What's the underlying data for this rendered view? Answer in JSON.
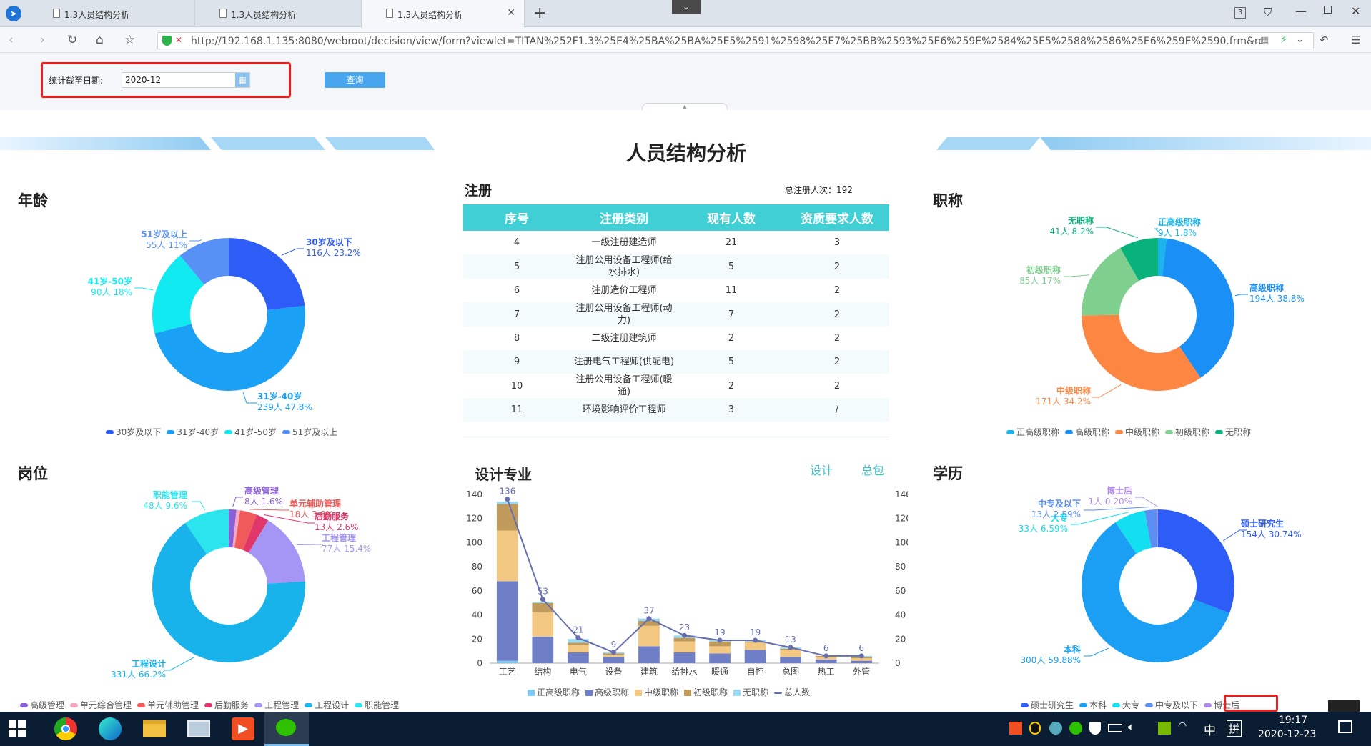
{
  "browser": {
    "tabs": [
      {
        "label": "1.3人员结构分析"
      },
      {
        "label": "1.3人员结构分析"
      },
      {
        "label": "1.3人员结构分析"
      }
    ],
    "url": "http://192.168.1.135:8080/webroot/decision/view/form?viewlet=TITAN%252F1.3%25E4%25BA%25BA%25E5%2591%2598%25E7%25BB%2593%25E6%259E%2584%25E5%2588%2586%25E6%259E%2590.frm&ref_t=design&re",
    "tab_count": "3"
  },
  "filter": {
    "label": "统计截至日期:",
    "date_value": "2020-12",
    "query_button": "查询"
  },
  "page_title": "人员结构分析",
  "age": {
    "title": "年龄",
    "slices": [
      {
        "name": "30岁及以下",
        "count": "116人",
        "pct": "23.2%",
        "value": 116,
        "color": "#2d5cf6"
      },
      {
        "name": "31岁-40岁",
        "count": "239人",
        "pct": "47.8%",
        "value": 239,
        "color": "#1aa0f5"
      },
      {
        "name": "41岁-50岁",
        "count": "90人",
        "pct": "18%",
        "value": 90,
        "color": "#10eaf0"
      },
      {
        "name": "51岁及以上",
        "count": "55人",
        "pct": "11%",
        "value": 55,
        "color": "#5891f5"
      }
    ]
  },
  "registration": {
    "title": "注册",
    "total_label": "总注册人次：192",
    "columns": [
      "序号",
      "注册类别",
      "现有人数",
      "资质要求人数"
    ],
    "rows": [
      {
        "no": "4",
        "type": "一级注册建造师",
        "current": "21",
        "required": "3",
        "alert": false
      },
      {
        "no": "5",
        "type": "注册公用设备工程师(给水排水)",
        "current": "5",
        "required": "2",
        "alert": false
      },
      {
        "no": "6",
        "type": "注册造价工程师",
        "current": "11",
        "required": "2",
        "alert": false
      },
      {
        "no": "7",
        "type": "注册公用设备工程师(动力)",
        "current": "7",
        "required": "2",
        "alert": false
      },
      {
        "no": "8",
        "type": "二级注册建筑师",
        "current": "2",
        "required": "2",
        "alert": true
      },
      {
        "no": "9",
        "type": "注册电气工程师(供配电)",
        "current": "5",
        "required": "2",
        "alert": false
      },
      {
        "no": "10",
        "type": "注册公用设备工程师(暖通)",
        "current": "2",
        "required": "2",
        "alert": true
      },
      {
        "no": "11",
        "type": "环境影响评价工程师",
        "current": "3",
        "required": "/",
        "alert": false
      }
    ]
  },
  "title_rank": {
    "title": "职称",
    "slices": [
      {
        "name": "正高级职称",
        "count": "9人",
        "pct": "1.8%",
        "value": 9,
        "color": "#1bb5ec"
      },
      {
        "name": "高级职称",
        "count": "194人",
        "pct": "38.8%",
        "value": 194,
        "color": "#1a8ff5"
      },
      {
        "name": "中级职称",
        "count": "171人",
        "pct": "34.2%",
        "value": 171,
        "color": "#fd8742"
      },
      {
        "name": "初级职称",
        "count": "85人",
        "pct": "17%",
        "value": 85,
        "color": "#7fcf8f"
      },
      {
        "name": "无职称",
        "count": "41人",
        "pct": "8.2%",
        "value": 41,
        "color": "#08b27a"
      }
    ]
  },
  "position": {
    "title": "岗位",
    "slices": [
      {
        "name": "高级管理",
        "count": "8人",
        "pct": "1.6%",
        "value": 8,
        "color": "#8a60d8"
      },
      {
        "name": "单元综合管理",
        "count": "",
        "pct": "",
        "value": 4,
        "color": "#f7a6c3"
      },
      {
        "name": "单元辅助管理",
        "count": "18人",
        "pct": "3.6%",
        "value": 18,
        "color": "#f05a5a"
      },
      {
        "name": "后勤服务",
        "count": "13人",
        "pct": "2.6%",
        "value": 13,
        "color": "#e0366a"
      },
      {
        "name": "工程管理",
        "count": "77人",
        "pct": "15.4%",
        "value": 77,
        "color": "#a595f5"
      },
      {
        "name": "工程设计",
        "count": "331人",
        "pct": "66.2%",
        "value": 331,
        "color": "#19b3eb"
      },
      {
        "name": "职能管理",
        "count": "48人",
        "pct": "9.6%",
        "value": 48,
        "color": "#2be4ee"
      }
    ]
  },
  "design": {
    "title": "设计专业",
    "link1": "设计",
    "link2": "总包",
    "chart_data": {
      "type": "bar",
      "categories": [
        "工艺",
        "结构",
        "电气",
        "设备",
        "建筑",
        "给排水",
        "暖通",
        "自控",
        "总图",
        "热工",
        "外管"
      ],
      "ylim": [
        0,
        140
      ],
      "yticks": [
        0,
        20,
        40,
        60,
        80,
        100,
        120,
        140
      ],
      "stacked": true,
      "series": [
        {
          "name": "正高级职称",
          "color": "#7ec8f0",
          "values": [
            2,
            0,
            0,
            0,
            0,
            0,
            0,
            0,
            0,
            0,
            0
          ]
        },
        {
          "name": "高级职称",
          "color": "#6f7fc7",
          "values": [
            66,
            22,
            9,
            5,
            14,
            9,
            8,
            11,
            5,
            3,
            2
          ]
        },
        {
          "name": "中级职称",
          "color": "#f3c882",
          "values": [
            42,
            20,
            6,
            2,
            17,
            9,
            6,
            6,
            6,
            2,
            2
          ]
        },
        {
          "name": "初级职称",
          "color": "#c09a5a",
          "values": [
            22,
            8,
            2,
            1,
            4,
            3,
            4,
            1,
            1,
            1,
            1
          ]
        },
        {
          "name": "无职称",
          "color": "#9bdaf5",
          "values": [
            2,
            1,
            3,
            1,
            2,
            2,
            1,
            1,
            1,
            0,
            1
          ]
        }
      ],
      "line": {
        "name": "总人数",
        "color": "#6670b0",
        "values": [
          136,
          53,
          21,
          9,
          37,
          23,
          19,
          19,
          13,
          6,
          6
        ]
      }
    }
  },
  "education": {
    "title": "学历",
    "slices": [
      {
        "name": "硕士研究生",
        "count": "154人",
        "pct": "30.74%",
        "value": 154,
        "color": "#2d5cf6"
      },
      {
        "name": "本科",
        "count": "300人",
        "pct": "59.88%",
        "value": 300,
        "color": "#1a9ff5"
      },
      {
        "name": "大专",
        "count": "33人",
        "pct": "6.59%",
        "value": 33,
        "color": "#12e0f0"
      },
      {
        "name": "中专及以下",
        "count": "13人",
        "pct": "2.59%",
        "value": 13,
        "color": "#5b8ef2"
      },
      {
        "name": "博士后",
        "count": "1人",
        "pct": "0.20%",
        "value": 1,
        "color": "#b08ae8"
      }
    ]
  },
  "taskbar": {
    "time": "19:17",
    "date": "2020-12-23",
    "ime1": "中",
    "ime2": "拼"
  }
}
